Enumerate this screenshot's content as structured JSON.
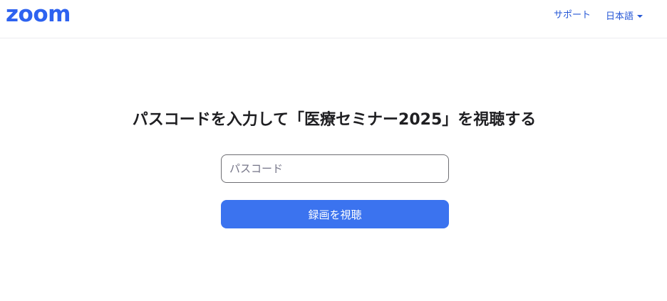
{
  "header": {
    "logo_text": "zoom",
    "nav": {
      "support_label": "サポート",
      "language_label": "日本語"
    }
  },
  "main": {
    "title": "パスコードを入力して「医療セミナー2025」を視聴する",
    "passcode": {
      "value": "",
      "placeholder": "パスコード"
    },
    "watch_button_label": "録画を視聴"
  },
  "colors": {
    "brand": "#2d62f0",
    "link": "#2557d6",
    "button": "#3b73ef"
  }
}
